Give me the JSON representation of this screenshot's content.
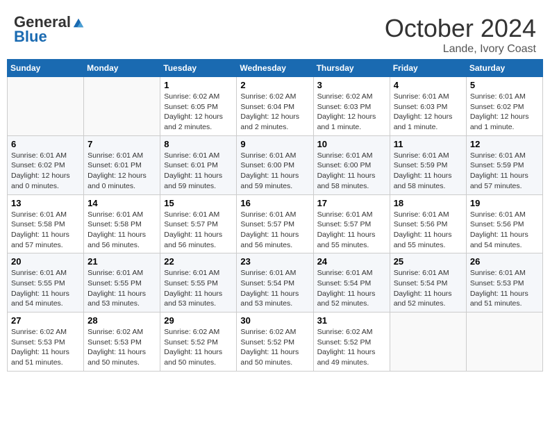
{
  "header": {
    "logo_line1": "General",
    "logo_line2": "Blue",
    "month": "October 2024",
    "location": "Lande, Ivory Coast"
  },
  "weekdays": [
    "Sunday",
    "Monday",
    "Tuesday",
    "Wednesday",
    "Thursday",
    "Friday",
    "Saturday"
  ],
  "weeks": [
    [
      {
        "day": "",
        "info": ""
      },
      {
        "day": "",
        "info": ""
      },
      {
        "day": "1",
        "info": "Sunrise: 6:02 AM\nSunset: 6:05 PM\nDaylight: 12 hours and 2 minutes."
      },
      {
        "day": "2",
        "info": "Sunrise: 6:02 AM\nSunset: 6:04 PM\nDaylight: 12 hours and 2 minutes."
      },
      {
        "day": "3",
        "info": "Sunrise: 6:02 AM\nSunset: 6:03 PM\nDaylight: 12 hours and 1 minute."
      },
      {
        "day": "4",
        "info": "Sunrise: 6:01 AM\nSunset: 6:03 PM\nDaylight: 12 hours and 1 minute."
      },
      {
        "day": "5",
        "info": "Sunrise: 6:01 AM\nSunset: 6:02 PM\nDaylight: 12 hours and 1 minute."
      }
    ],
    [
      {
        "day": "6",
        "info": "Sunrise: 6:01 AM\nSunset: 6:02 PM\nDaylight: 12 hours and 0 minutes."
      },
      {
        "day": "7",
        "info": "Sunrise: 6:01 AM\nSunset: 6:01 PM\nDaylight: 12 hours and 0 minutes."
      },
      {
        "day": "8",
        "info": "Sunrise: 6:01 AM\nSunset: 6:01 PM\nDaylight: 11 hours and 59 minutes."
      },
      {
        "day": "9",
        "info": "Sunrise: 6:01 AM\nSunset: 6:00 PM\nDaylight: 11 hours and 59 minutes."
      },
      {
        "day": "10",
        "info": "Sunrise: 6:01 AM\nSunset: 6:00 PM\nDaylight: 11 hours and 58 minutes."
      },
      {
        "day": "11",
        "info": "Sunrise: 6:01 AM\nSunset: 5:59 PM\nDaylight: 11 hours and 58 minutes."
      },
      {
        "day": "12",
        "info": "Sunrise: 6:01 AM\nSunset: 5:59 PM\nDaylight: 11 hours and 57 minutes."
      }
    ],
    [
      {
        "day": "13",
        "info": "Sunrise: 6:01 AM\nSunset: 5:58 PM\nDaylight: 11 hours and 57 minutes."
      },
      {
        "day": "14",
        "info": "Sunrise: 6:01 AM\nSunset: 5:58 PM\nDaylight: 11 hours and 56 minutes."
      },
      {
        "day": "15",
        "info": "Sunrise: 6:01 AM\nSunset: 5:57 PM\nDaylight: 11 hours and 56 minutes."
      },
      {
        "day": "16",
        "info": "Sunrise: 6:01 AM\nSunset: 5:57 PM\nDaylight: 11 hours and 56 minutes."
      },
      {
        "day": "17",
        "info": "Sunrise: 6:01 AM\nSunset: 5:57 PM\nDaylight: 11 hours and 55 minutes."
      },
      {
        "day": "18",
        "info": "Sunrise: 6:01 AM\nSunset: 5:56 PM\nDaylight: 11 hours and 55 minutes."
      },
      {
        "day": "19",
        "info": "Sunrise: 6:01 AM\nSunset: 5:56 PM\nDaylight: 11 hours and 54 minutes."
      }
    ],
    [
      {
        "day": "20",
        "info": "Sunrise: 6:01 AM\nSunset: 5:55 PM\nDaylight: 11 hours and 54 minutes."
      },
      {
        "day": "21",
        "info": "Sunrise: 6:01 AM\nSunset: 5:55 PM\nDaylight: 11 hours and 53 minutes."
      },
      {
        "day": "22",
        "info": "Sunrise: 6:01 AM\nSunset: 5:55 PM\nDaylight: 11 hours and 53 minutes."
      },
      {
        "day": "23",
        "info": "Sunrise: 6:01 AM\nSunset: 5:54 PM\nDaylight: 11 hours and 53 minutes."
      },
      {
        "day": "24",
        "info": "Sunrise: 6:01 AM\nSunset: 5:54 PM\nDaylight: 11 hours and 52 minutes."
      },
      {
        "day": "25",
        "info": "Sunrise: 6:01 AM\nSunset: 5:54 PM\nDaylight: 11 hours and 52 minutes."
      },
      {
        "day": "26",
        "info": "Sunrise: 6:01 AM\nSunset: 5:53 PM\nDaylight: 11 hours and 51 minutes."
      }
    ],
    [
      {
        "day": "27",
        "info": "Sunrise: 6:02 AM\nSunset: 5:53 PM\nDaylight: 11 hours and 51 minutes."
      },
      {
        "day": "28",
        "info": "Sunrise: 6:02 AM\nSunset: 5:53 PM\nDaylight: 11 hours and 50 minutes."
      },
      {
        "day": "29",
        "info": "Sunrise: 6:02 AM\nSunset: 5:52 PM\nDaylight: 11 hours and 50 minutes."
      },
      {
        "day": "30",
        "info": "Sunrise: 6:02 AM\nSunset: 5:52 PM\nDaylight: 11 hours and 50 minutes."
      },
      {
        "day": "31",
        "info": "Sunrise: 6:02 AM\nSunset: 5:52 PM\nDaylight: 11 hours and 49 minutes."
      },
      {
        "day": "",
        "info": ""
      },
      {
        "day": "",
        "info": ""
      }
    ]
  ]
}
